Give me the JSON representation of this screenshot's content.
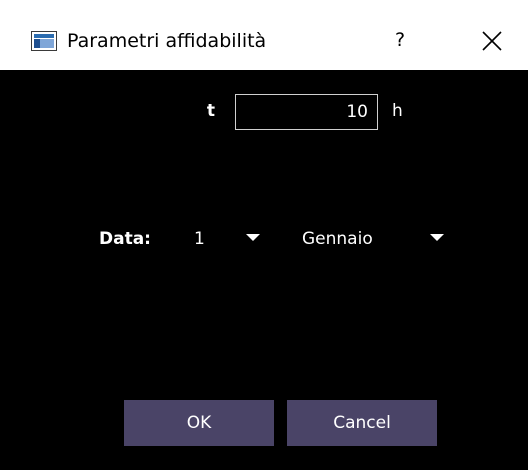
{
  "window": {
    "title": "Parametri affidabilità",
    "help_label": "?",
    "title_icon": "app-window-icon",
    "close_icon": "close-icon"
  },
  "form": {
    "t_label": "t",
    "t_value": "10",
    "t_unit": "h",
    "date_label": "Data:",
    "day_value": "1",
    "month_value": "Gennaio",
    "dropdown_icon": "chevron-down-icon"
  },
  "buttons": {
    "ok_label": "OK",
    "cancel_label": "Cancel"
  },
  "colors": {
    "window_background": "#000000",
    "titlebar_background": "#ffffff",
    "button_background": "#4a4467",
    "text": "#ffffff"
  }
}
